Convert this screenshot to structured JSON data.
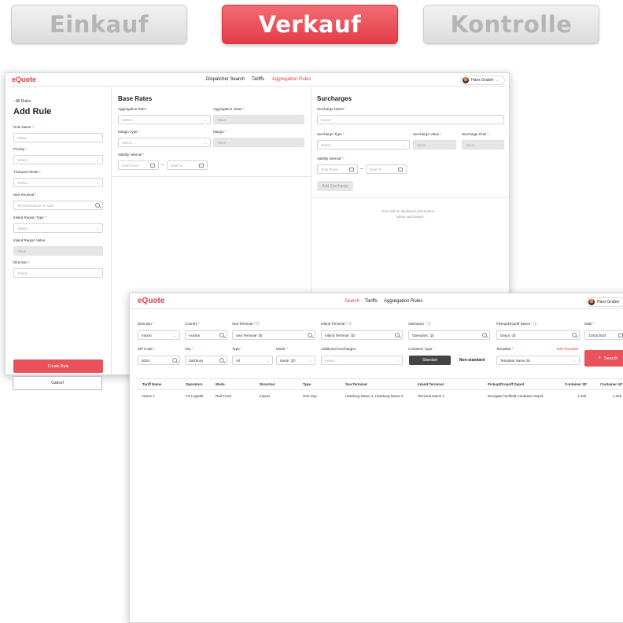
{
  "tabs": {
    "einkauf": "Einkauf",
    "verkauf": "Verkauf",
    "kontrolle": "Kontrolle"
  },
  "back_window": {
    "logo": "eQuote",
    "nav": {
      "dispatcher": "Dispatcher Search",
      "tariffs": "Tariffs",
      "aggregation": "Aggregation Rules"
    },
    "user": "Hans Gruber",
    "sidebar": {
      "back": "‹  All Rules",
      "title": "Add Rule",
      "rule_name_label": "Rule Name",
      "rule_name_ph": "Name",
      "priority_label": "Priority",
      "priority_ph": "Select...",
      "transport_label": "Transport Mode",
      "transport_ph": "Select...",
      "sea_label": "Sea Terminal",
      "sea_ph": "Terminal Name or Alias",
      "inland_type_label": "Inland Region Type",
      "inland_type_ph": "Select...",
      "inland_value_label": "Inland Region Value",
      "inland_value_ph": "Value",
      "direction_label": "Direction",
      "direction_ph": "Select...",
      "create_btn": "Create Rule",
      "cancel_btn": "Cancel"
    },
    "base_rates": {
      "title": "Base Rates",
      "agg_rule_label": "Aggregation Rule",
      "agg_rule_ph": "Select...",
      "agg_value_label": "Aggregation Value",
      "agg_value_ph": "Value",
      "margin_type_label": "Margin Type",
      "margin_type_ph": "Select...",
      "margin_label": "Margin",
      "margin_ph": "Value",
      "validity_label": "Validity Interval",
      "date_from": "Date From",
      "date_to": "Date To"
    },
    "surcharges": {
      "title": "Surcharges",
      "name_label": "Surcharge Name",
      "name_ph": "Name",
      "type_label": "Surcharge Type",
      "type_ph": "Select...",
      "value_label": "Surcharge Value",
      "value_ph": "Value",
      "rule_label": "Surcharge Rule",
      "rule_ph": "Value",
      "validity_label": "Validity Interval",
      "date_from": "Date From",
      "date_to": "Date To",
      "add_btn": "Add Surcharge",
      "info_line1": "Here will be displayed information",
      "info_line2": "about surcharges."
    }
  },
  "front_window": {
    "logo": "eQuote",
    "nav": {
      "search": "Search",
      "tariffs": "Tariffs",
      "aggregation": "Aggregation Rules"
    },
    "user": "Hans Gruber",
    "filters": {
      "direction_label": "Direction",
      "direction_val": "Import",
      "country_label": "Country",
      "country_val": "Austria",
      "sea_label": "Sea Terminal",
      "sea_val": "Sea Terminal",
      "sea_count": "5",
      "inland_label": "Inland Terminal",
      "inland_val": "Inland Terminal",
      "inland_count": "2",
      "operators_label": "Operators",
      "operators_val": "Operators",
      "operators_count": "2",
      "depot_label": "Pickup/Dropoff Depot",
      "depot_val": "Depot",
      "depot_count": "2",
      "date_label": "Date",
      "date_val": "21/02/2024",
      "zip_label": "ZIP Code",
      "zip_val": "5020",
      "city_label": "City",
      "city_val": "Salzburg",
      "type_label": "Type",
      "type_val": "All",
      "mode_label": "Mode",
      "mode_val": "Mode",
      "mode_count": "2",
      "addsur_label": "Additional Surcharges",
      "addsur_ph": "Select...",
      "container_label": "Container Type",
      "container_std": "Standart",
      "container_non": "Non-standard",
      "template_label": "Template",
      "template_val": "Template Name 25",
      "edit_template": "Edit Template",
      "search_btn": "Search"
    },
    "table": {
      "headers": [
        "Tariff Name",
        "Operators",
        "Mode",
        "Direction",
        "Type",
        "Sea Terminal",
        "Inland Terminal",
        "Pickup/Dropoff Depot",
        "Container 20'",
        "Container 40'"
      ],
      "rows": [
        [
          "Name 1",
          "TX Logistik,",
          "Rail-Truck",
          "Import",
          "One way",
          "Hamburg Name 1, Hamburg Name 2",
          "Terminal Name 1",
          "Eurogate Tankfeld Container Depot",
          "1.345",
          "1.345"
        ]
      ]
    }
  }
}
